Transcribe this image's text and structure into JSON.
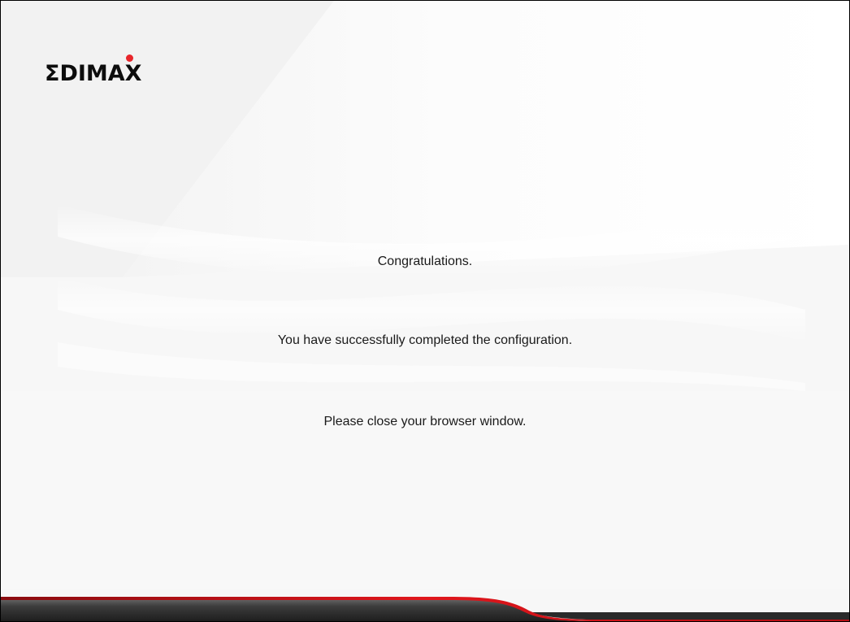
{
  "brand": {
    "name": "ΣDIMAX",
    "accent_color": "#e8262b"
  },
  "content": {
    "line_1": "Congratulations.",
    "line_2": "You have successfully completed the configuration.",
    "line_3": "Please close your browser window."
  },
  "colors": {
    "footer_dark": "#3a3a3a",
    "footer_accent": "#c8141a"
  }
}
